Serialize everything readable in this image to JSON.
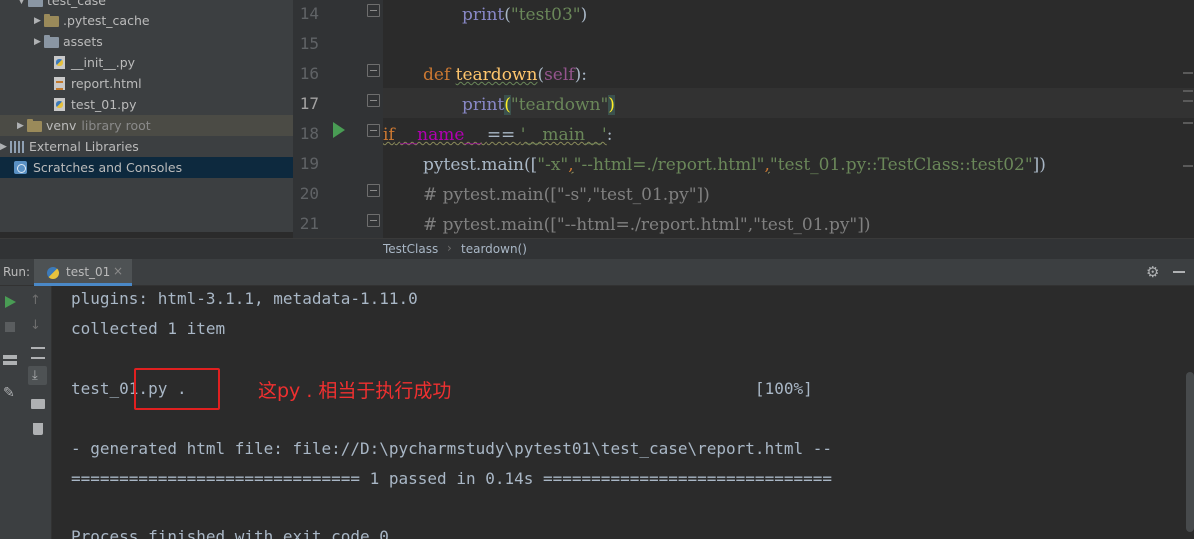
{
  "project_tree": {
    "items": [
      {
        "label": "test_case",
        "note": ""
      },
      {
        "label": ".pytest_cache",
        "note": ""
      },
      {
        "label": "assets",
        "note": ""
      },
      {
        "label": "__init__.py",
        "note": ""
      },
      {
        "label": "report.html",
        "note": ""
      },
      {
        "label": "test_01.py",
        "note": ""
      },
      {
        "label": "venv",
        "note": "library root"
      },
      {
        "label": "External Libraries",
        "note": ""
      },
      {
        "label": "Scratches and Consoles",
        "note": ""
      }
    ]
  },
  "editor": {
    "line_numbers": [
      "14",
      "15",
      "16",
      "17",
      "18",
      "19",
      "20",
      "21"
    ],
    "line14": {
      "kw": "print",
      "open": "(",
      "str": "\"test03\"",
      "close": ")"
    },
    "line16": {
      "def": "def",
      "name": "teardown",
      "open": "(",
      "self": "self",
      "close": "):"
    },
    "line17": {
      "kw": "print",
      "open": "(",
      "str": "\"teardown\"",
      "close": ")"
    },
    "line18": {
      "if": "if",
      "name": "__name__",
      "eq": "==",
      "str": "'__main__'",
      "colon": ":"
    },
    "line19": {
      "call": "pytest.main([",
      "a1": "\"-x\"",
      "c1": ",",
      "a2": "\"--html=./report.html\"",
      "c2": ",",
      "a3": "\"test_01.py::TestClass::test02\"",
      "end": "])"
    },
    "line20": {
      "comment": "# pytest.main([\"-s\",\"test_01.py\"])"
    },
    "line21": {
      "comment": "# pytest.main([\"--html=./report.html\",\"test_01.py\"])"
    },
    "breadcrumb": [
      "TestClass",
      "teardown()"
    ]
  },
  "run_panel": {
    "label": "Run:",
    "tab": "test_01",
    "tab_close": "×",
    "console_lines": [
      "plugins: html-3.1.1, metadata-1.11.0",
      "collected 1 item",
      "",
      "test_01.py .                                                           [100%]",
      "",
      "- generated html file: file://D:\\pycharmstudy\\pytest01\\test_case\\report.html --",
      "============================== 1 passed in 0.14s ==============================",
      "",
      "Process finished with exit code 0"
    ]
  },
  "annotation": {
    "text": "这py . 相当于执行成功",
    "color": "#f03030"
  }
}
